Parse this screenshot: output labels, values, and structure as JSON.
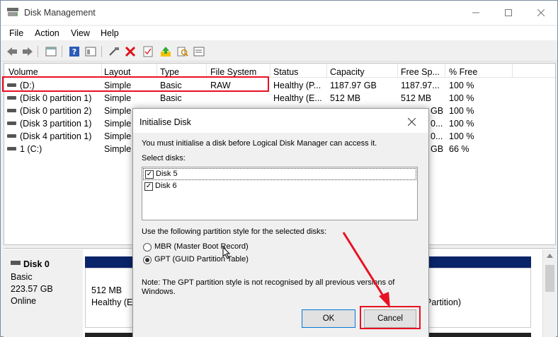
{
  "window": {
    "title": "Disk Management"
  },
  "menu": [
    "File",
    "Action",
    "View",
    "Help"
  ],
  "toolbar": {
    "icons": [
      "back-icon",
      "forward-icon",
      "properties-icon",
      "help-icon",
      "view-icon",
      "connect-icon",
      "delete-icon",
      "check-icon",
      "import-icon",
      "search-icon",
      "console-icon"
    ]
  },
  "columns": [
    "Volume",
    "Layout",
    "Type",
    "File System",
    "Status",
    "Capacity",
    "Free Sp...",
    "% Free"
  ],
  "volumes": [
    {
      "volume": "(D:)",
      "layout": "Simple",
      "type": "Basic",
      "fs": "RAW",
      "status": "Healthy (P...",
      "capacity": "1187.97 GB",
      "free": "1187.97...",
      "pct": "100 %"
    },
    {
      "volume": "(Disk 0 partition 1)",
      "layout": "Simple",
      "type": "Basic",
      "fs": "",
      "status": "Healthy (E...",
      "capacity": "512 MB",
      "free": "512 MB",
      "pct": "100 %"
    },
    {
      "volume": "(Disk 0 partition 2)",
      "layout": "Simple",
      "type": "",
      "fs": "",
      "status": "",
      "capacity": "",
      "free": "GB",
      "pct": "100 %"
    },
    {
      "volume": "(Disk 3 partition 1)",
      "layout": "Simple",
      "type": "",
      "fs": "",
      "status": "",
      "capacity": "",
      "free": "0...",
      "pct": "100 %"
    },
    {
      "volume": "(Disk 4 partition 1)",
      "layout": "Simple",
      "type": "",
      "fs": "",
      "status": "",
      "capacity": "",
      "free": "0...",
      "pct": "100 %"
    },
    {
      "volume": "1 (C:)",
      "layout": "Simple",
      "type": "",
      "fs": "",
      "status": "",
      "capacity": "",
      "free": "GB",
      "pct": "66 %"
    }
  ],
  "disk0": {
    "name": "Disk 0",
    "type": "Basic",
    "size": "223.57 GB",
    "state": "Online",
    "partition_size": "512 MB",
    "partition_status": "Healthy (Ef",
    "partition_right": "Partition)"
  },
  "dialog": {
    "title": "Initialise Disk",
    "message": "You must initialise a disk before Logical Disk Manager can access it.",
    "select_label": "Select disks:",
    "disks": [
      {
        "label": "Disk 5",
        "checked": true
      },
      {
        "label": "Disk 6",
        "checked": true
      }
    ],
    "style_label": "Use the following partition style for the selected disks:",
    "mbr_label": "MBR (Master Boot Record)",
    "gpt_label": "GPT (GUID Partition Table)",
    "selected_style": "GPT",
    "note_line1": "Note: The GPT partition style is not recognised by all previous versions of",
    "note_line2": "Windows.",
    "ok_label": "OK",
    "cancel_label": "Cancel"
  },
  "colors": {
    "highlight": "#e81123",
    "disk_bar": "#0a246a",
    "ok_border": "#0078d7"
  }
}
